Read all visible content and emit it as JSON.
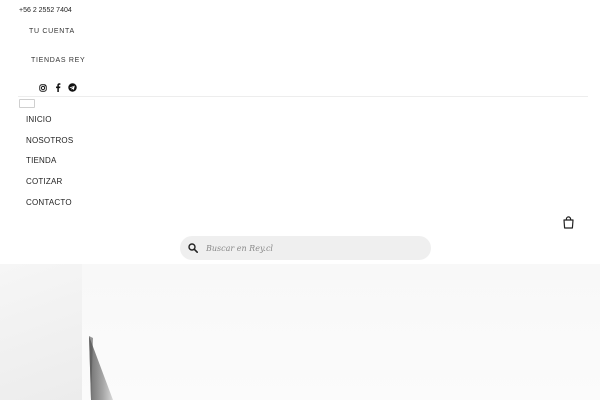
{
  "topbar": {
    "phone": "+56 2 2552 7404",
    "account_label": "TU CUENTA",
    "stores_label": "TIENDAS REY"
  },
  "socials": [
    {
      "icon": "instagram-icon"
    },
    {
      "icon": "facebook-icon"
    },
    {
      "icon": "telegram-icon"
    }
  ],
  "nav": {
    "items": [
      "INICIO",
      "NOSOTROS",
      "TIENDA",
      "COTIZAR",
      "CONTACTO"
    ]
  },
  "search": {
    "placeholder": "Buscar en Rey.cl"
  },
  "icons": {
    "cart": "shopping-bag-icon",
    "search": "search-icon"
  },
  "colors": {
    "text": "#1a1a1a",
    "search_bg": "#efefef",
    "divider": "#ededed"
  }
}
